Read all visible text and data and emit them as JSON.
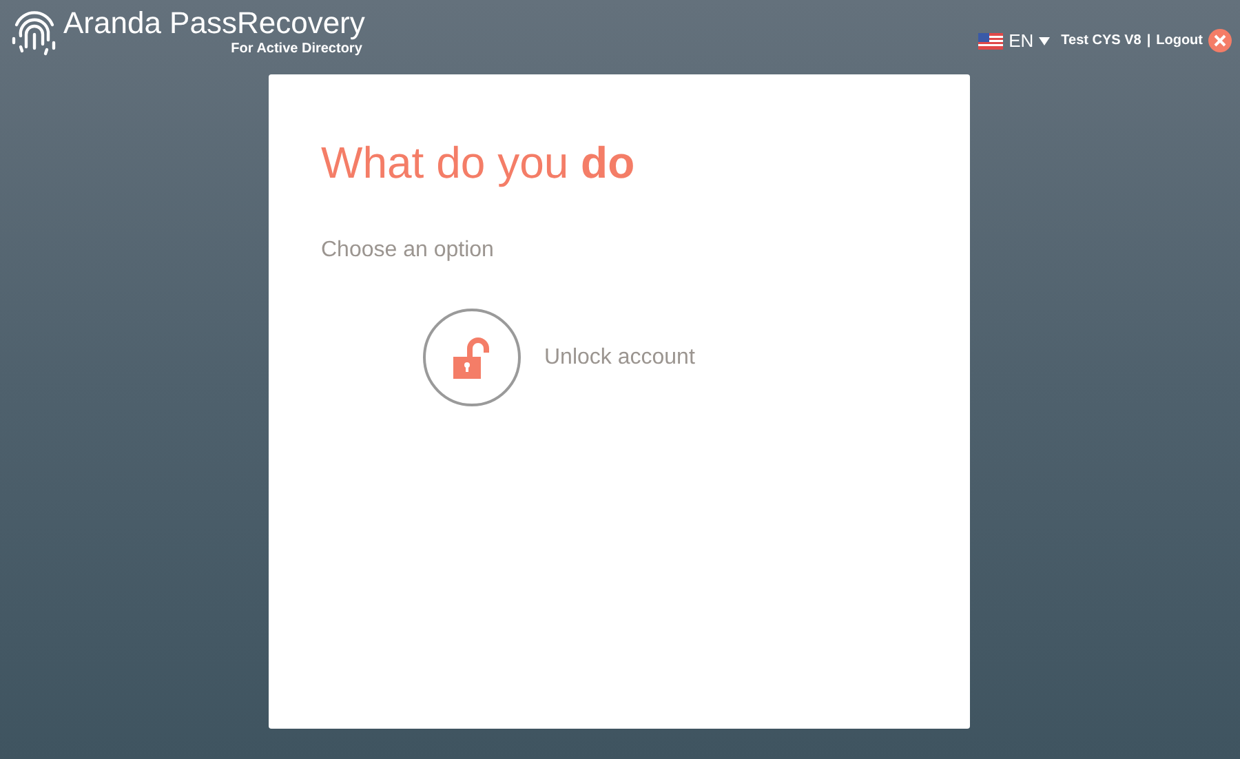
{
  "header": {
    "brand": "Aranda PassRecovery",
    "subtitle": "For Active Directory",
    "language": "EN",
    "user": "Test CYS V8",
    "separator": "|",
    "logout": "Logout"
  },
  "card": {
    "title": "What do you **do**",
    "prompt": "Choose an option",
    "options": [
      {
        "kind": "unlock",
        "label": "Unlock account"
      }
    ]
  }
}
